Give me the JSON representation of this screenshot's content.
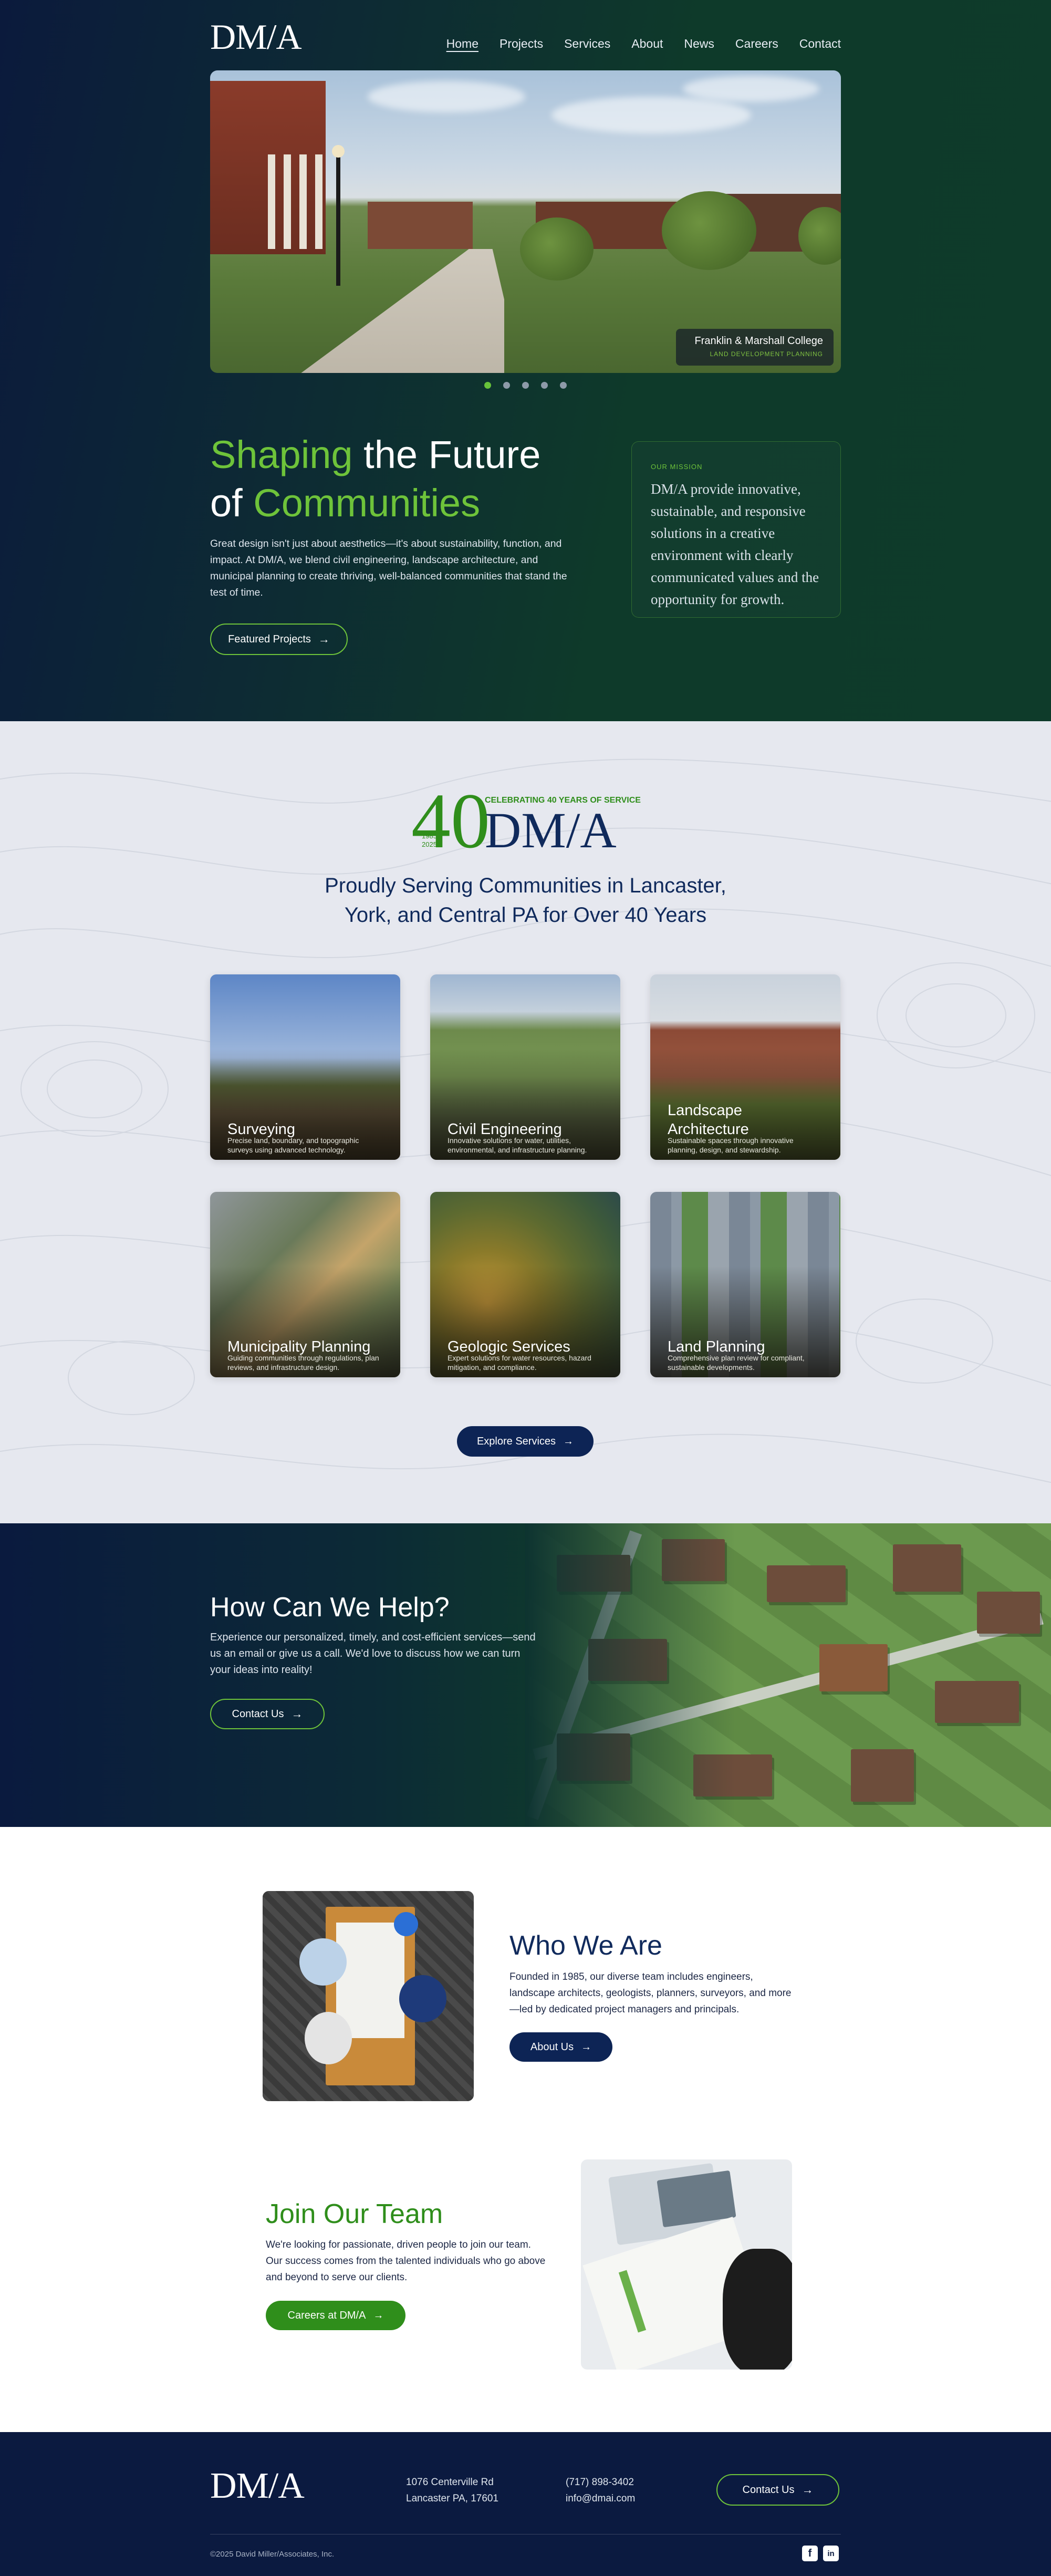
{
  "brand": {
    "logo": "DM/A",
    "accent": "#6ec33a",
    "navy": "#0d2455",
    "green": "#2f8e1b"
  },
  "nav": {
    "items": [
      {
        "label": "Home"
      },
      {
        "label": "Projects"
      },
      {
        "label": "Services"
      },
      {
        "label": "About"
      },
      {
        "label": "News"
      },
      {
        "label": "Careers"
      },
      {
        "label": "Contact"
      }
    ]
  },
  "hero": {
    "caption_title": "Franklin & Marshall College",
    "caption_sub": "LAND DEVELOPMENT PLANNING",
    "slides_total": 5,
    "slide_active": 1,
    "title_accent_1": "Shaping",
    "title_plain_1": " the Future",
    "title_plain_2": "of ",
    "title_accent_2": "Communities",
    "paragraph": "Great design isn't just about aesthetics—it's about sustainability, function, and impact. At DM/A, we blend civil engineering, landscape architecture, and municipal planning to create thriving, well-balanced communities that stand the test of time.",
    "button": "Featured Projects",
    "mission_label": "OUR MISSION",
    "mission_text": "DM/A provide innovative, sustainable, and responsive solutions in a creative environment with clearly communicated values and the opportunity for growth."
  },
  "badge": {
    "big": "40",
    "celebrating": "CELEBRATING 40 YEARS OF SERVICE",
    "year_start": "1985",
    "year_end": "2025",
    "wordmark": "DM/A"
  },
  "services": {
    "title_line1": "Proudly Serving Communities in Lancaster,",
    "title_line2": "York, and Central PA  for Over 40 Years",
    "cards": [
      {
        "title": "Surveying",
        "desc": "Precise land, boundary, and topographic surveys using advanced technology."
      },
      {
        "title": "Civil Engineering",
        "desc": "Innovative solutions for water, utilities, environmental, and infrastructure planning."
      },
      {
        "title": "Landscape Architecture",
        "desc": "Sustainable spaces through innovative planning, design, and stewardship."
      },
      {
        "title": "Municipality Planning",
        "desc": "Guiding communities through regulations, plan reviews, and infrastructure design."
      },
      {
        "title": "Geologic Services",
        "desc": "Expert solutions for water resources, hazard mitigation, and compliance."
      },
      {
        "title": "Land Planning",
        "desc": "Comprehensive plan review for compliant, sustainable developments."
      }
    ],
    "button": "Explore Services"
  },
  "help": {
    "title": "How Can We Help?",
    "paragraph": "Experience our personalized, timely, and cost-efficient services—send us an email or give us a call. We'd love to discuss how we can turn your ideas into reality!",
    "button": "Contact Us"
  },
  "who": {
    "title": "Who We Are",
    "paragraph": "Founded in 1985, our diverse team includes engineers, landscape architects, geologists, planners, surveyors, and more—led by dedicated project managers and principals.",
    "button": "About Us"
  },
  "join": {
    "title": "Join Our Team",
    "paragraph": "We're looking for passionate, driven people to join our team. Our success comes from the talented individuals who go above and beyond to serve our clients.",
    "button": "Careers at DM/A"
  },
  "footer": {
    "logo": "DM/A",
    "address_line1": "1076 Centerville Rd",
    "address_line2": "Lancaster PA, 17601",
    "phone": "(717) 898-3402",
    "email": "info@dmai.com",
    "button": "Contact Us",
    "copyright": "©2025 David Miller/Associates, Inc.",
    "social": [
      {
        "icon": "facebook-icon",
        "glyph": "f"
      },
      {
        "icon": "linkedin-icon",
        "glyph": "in"
      }
    ]
  }
}
